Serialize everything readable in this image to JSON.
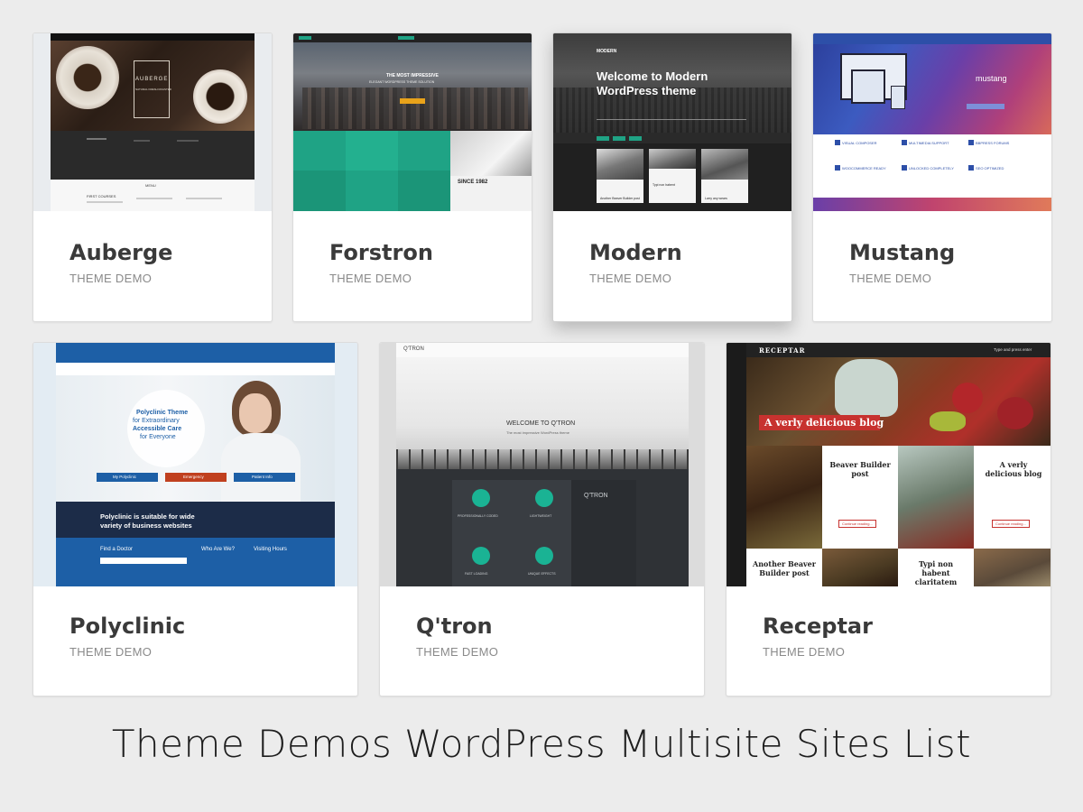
{
  "colors": {
    "background": "#ececec",
    "card": "#ffffff",
    "title": "#3a3a3a",
    "subtitle": "#8a8a8a",
    "forstron_green": "#1fa385",
    "mustang_blue": "#2d4fa8",
    "polyclinic_blue": "#1d5fa6",
    "qtron_teal": "#1ab394",
    "receptar_red": "#c7322f"
  },
  "caption": "Theme Demos WordPress Multisite Sites List",
  "cards": [
    {
      "name": "Auberge",
      "label": "THEME DEMO",
      "preview": {
        "logo_text": "AUBERGE",
        "logo_sub": "NATURAL FRESH ROASTED",
        "menu_heading": "MENU",
        "section": "FIRST COURSES"
      }
    },
    {
      "name": "Forstron",
      "label": "THEME DEMO",
      "preview": {
        "headline": "THE MOST IMPRESSIVE",
        "sub": "ELEGANT WORDPRESS THEME SOLUTION",
        "badge": "SINCE 1982"
      }
    },
    {
      "name": "Modern",
      "label": "THEME DEMO",
      "preview": {
        "logo": "MODERN",
        "headline": "Welcome to Modern WordPress theme",
        "posts": [
          "Another Beaver Builder post",
          "Typi non habent",
          "Larry any wears"
        ]
      }
    },
    {
      "name": "Mustang",
      "label": "THEME DEMO",
      "preview": {
        "logo": "mustang",
        "features": [
          "VISUAL COMPOSER",
          "MULTIMEDIA SUPPORT",
          "BBPRESS FORUMS",
          "WOOCOMMERCE READY",
          "UNLOCKED COMPLETELY",
          "SEO OPTIMIZED"
        ]
      }
    },
    {
      "name": "Polyclinic",
      "label": "THEME DEMO",
      "preview": {
        "hero_lines": [
          "Polyclinic Theme",
          "for Extraordinary",
          "Accessible Care",
          "for Everyone"
        ],
        "buttons": [
          "My Polyclinic",
          "Emergency",
          "Patient Info"
        ],
        "tagline_lines": [
          "Polyclinic is suitable for wide",
          "variety of business websites"
        ],
        "cols": [
          "Find a Doctor",
          "Who Are We?",
          "Visiting Hours"
        ]
      }
    },
    {
      "name": "Q'tron",
      "label": "THEME DEMO",
      "preview": {
        "logo": "Q'TRON",
        "welcome": "WELCOME TO Q'TRON",
        "sub": "The most impressive WordPress theme",
        "features": [
          "PROFESSIONALLY CODED",
          "LIGHTWEIGHT",
          "FAST LOADING",
          "UNIQUE EFFECTS"
        ],
        "side_title": "Q'TRON"
      }
    },
    {
      "name": "Receptar",
      "label": "THEME DEMO",
      "preview": {
        "logo": "RECEPTAR",
        "search": "Type and press enter",
        "banner": "A verly delicious blog",
        "post1": "Beaver Builder post",
        "post2": "A verly delicious blog",
        "post3": "Another Beaver Builder post",
        "post4": "Typi non habent claritatem",
        "more": "Continue reading..."
      }
    }
  ]
}
